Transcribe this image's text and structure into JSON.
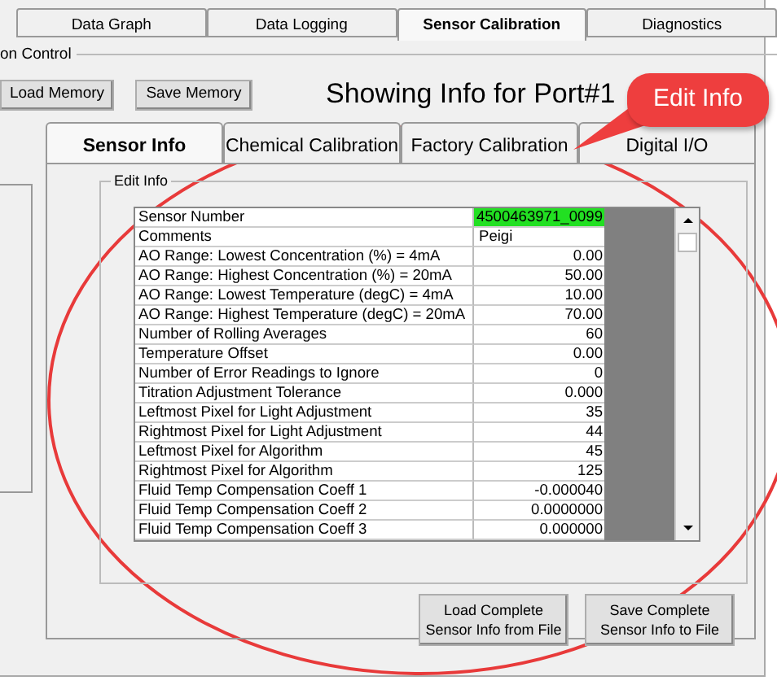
{
  "top_tabs": [
    {
      "label": "Data Graph",
      "selected": false
    },
    {
      "label": "Data Logging",
      "selected": false
    },
    {
      "label": "Sensor Calibration",
      "selected": true
    },
    {
      "label": "Diagnostics",
      "selected": false
    }
  ],
  "group": {
    "title": "on Control"
  },
  "memory_buttons": [
    "Load Memory",
    "Save Memory"
  ],
  "port_title": "Showing Info for Port#1",
  "callout": {
    "text": "Edit Info"
  },
  "inner_tabs": [
    {
      "label": "Sensor Info",
      "selected": true
    },
    {
      "label": "Chemical Calibration",
      "selected": false
    },
    {
      "label": "Factory Calibration",
      "selected": false
    },
    {
      "label": "Digital I/O",
      "selected": false
    }
  ],
  "edit_info": {
    "title": "Edit Info",
    "rows": [
      {
        "name": "Sensor Number",
        "value": "4500463971_0099",
        "highlighted": true
      },
      {
        "name": "Comments",
        "value": "Peigi",
        "highlighted": false
      },
      {
        "name": "AO Range: Lowest Concentration (%) = 4mA",
        "value": "0.00",
        "highlighted": false
      },
      {
        "name": "AO Range: Highest Concentration (%) = 20mA",
        "value": "50.00",
        "highlighted": false
      },
      {
        "name": "AO Range: Lowest Temperature (degC) = 4mA",
        "value": "10.00",
        "highlighted": false
      },
      {
        "name": "AO Range: Highest Temperature (degC) = 20mA",
        "value": "70.00",
        "highlighted": false
      },
      {
        "name": "Number of Rolling Averages",
        "value": "60",
        "highlighted": false
      },
      {
        "name": "Temperature Offset",
        "value": "0.00",
        "highlighted": false
      },
      {
        "name": "Number of Error Readings to Ignore",
        "value": "0",
        "highlighted": false
      },
      {
        "name": "Titration Adjustment Tolerance",
        "value": "0.000",
        "highlighted": false
      },
      {
        "name": "Leftmost Pixel for Light Adjustment",
        "value": "35",
        "highlighted": false
      },
      {
        "name": "Rightmost Pixel for Light Adjustment",
        "value": "44",
        "highlighted": false
      },
      {
        "name": "Leftmost Pixel for Algorithm",
        "value": "45",
        "highlighted": false
      },
      {
        "name": "Rightmost Pixel for Algorithm",
        "value": "125",
        "highlighted": false
      },
      {
        "name": "Fluid Temp Compensation Coeff 1",
        "value": "-0.000040",
        "highlighted": false
      },
      {
        "name": "Fluid Temp Compensation Coeff 2",
        "value": "0.0000000",
        "highlighted": false
      },
      {
        "name": "Fluid Temp Compensation Coeff 3",
        "value": "0.000000",
        "highlighted": false
      }
    ]
  },
  "file_buttons": [
    "Load Complete Sensor Info from File",
    "Save Complete Sensor Info to File"
  ]
}
